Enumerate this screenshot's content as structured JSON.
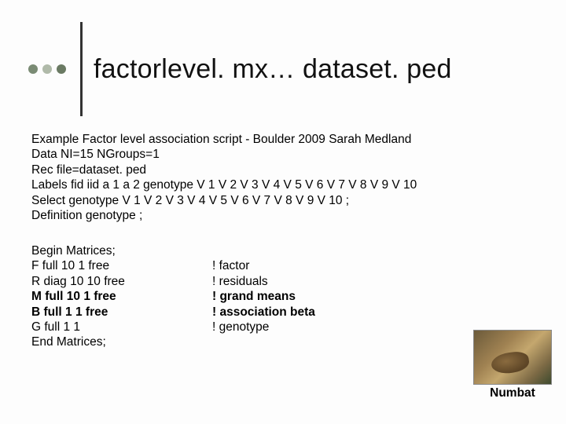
{
  "title": "factorlevel. mx… dataset. ped",
  "body": {
    "l1": "Example Factor level association script - Boulder 2009 Sarah Medland",
    "l2": "Data NI=15 NGroups=1",
    "l3": "Rec file=dataset. ped",
    "l4": "Labels fid iid a 1 a 2 genotype  V 1 V 2 V 3 V 4 V 5 V 6 V 7 V 8 V 9 V 10",
    "l5": "Select genotype  V 1 V 2 V 3 V 4 V 5 V 6 V 7 V 8 V 9 V 10 ;",
    "l6": "Definition genotype ;"
  },
  "matrices": {
    "r1l": "Begin Matrices;",
    "r1r": "",
    "r2l": "F full 10 1 free",
    "r2r": "! factor",
    "r3l": "R diag 10 10 free",
    "r3r": "! residuals",
    "r4l": "M full 10 1 free",
    "r4r": "! grand means",
    "r5l": "B full 1 1 free",
    "r5r": "! association beta",
    "r6l": "G full 1 1",
    "r6r": "! genotype",
    "r7l": "End Matrices;",
    "r7r": ""
  },
  "caption": "Numbat"
}
